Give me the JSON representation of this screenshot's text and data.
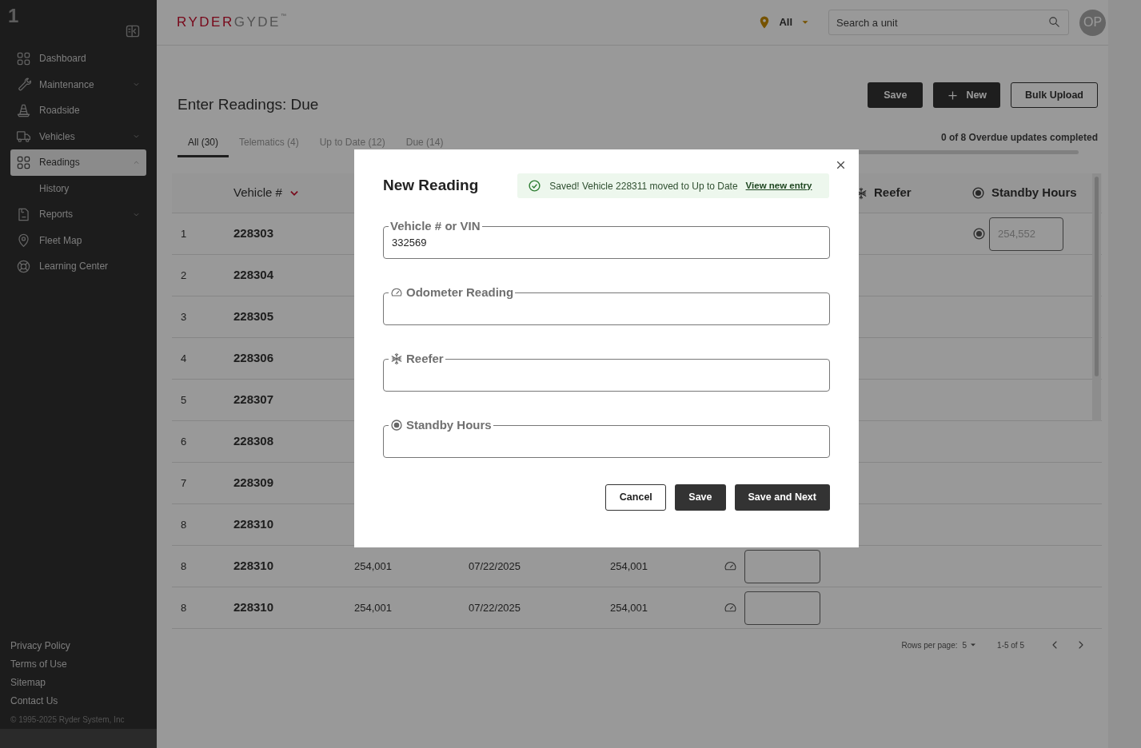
{
  "sidebar": {
    "brand_mark": "1",
    "items": [
      {
        "label": "Dashboard",
        "selected": false
      },
      {
        "label": "Maintenance",
        "selected": false,
        "expanded": false
      },
      {
        "label": "Roadside",
        "selected": false
      },
      {
        "label": "Vehicles",
        "selected": false,
        "expanded": false
      },
      {
        "label": "Readings",
        "selected": true,
        "expanded": true,
        "children": [
          {
            "label": "History",
            "selected": false
          }
        ]
      },
      {
        "label": "Reports",
        "selected": false,
        "expanded": false
      },
      {
        "label": "Fleet Map",
        "selected": false
      },
      {
        "label": "Learning Center",
        "selected": false
      }
    ],
    "footer_links": [
      "Privacy Policy",
      "Terms of Use",
      "Sitemap",
      "Contact Us"
    ],
    "copyright": "© 1995-2025 Ryder System, Inc"
  },
  "header": {
    "logo_primary": "RYDER",
    "logo_secondary": "GYDE",
    "logo_mark": "™",
    "location": "All",
    "search": {
      "placeholder": "Search a unit"
    },
    "avatar": "OP"
  },
  "page": {
    "title": "Enter Readings: Due",
    "actions": [
      {
        "label": "Save",
        "kind": "primary"
      },
      {
        "label": "New",
        "kind": "add"
      },
      {
        "label": "Bulk Upload",
        "kind": "outline"
      }
    ],
    "progress": {
      "text": "0 of 8 Overdue updates completed",
      "level": 0
    }
  },
  "tabs": [
    {
      "label": "All (30)",
      "selected": true
    },
    {
      "label": "Telematics (4)",
      "selected": false
    },
    {
      "label": "Up to Date (12)",
      "selected": false
    },
    {
      "label": "Due (14)",
      "selected": false
    }
  ],
  "table": {
    "columns": [
      {
        "label": "Vehicle #",
        "kind": "sort"
      },
      {
        "label": "Reefer",
        "kind": "reefer"
      },
      {
        "label": "Standby Hours",
        "kind": "standby"
      }
    ],
    "rows": [
      {
        "number": "1",
        "vehicle": "228303",
        "standby_placeholder": "254,552"
      },
      {
        "number": "2",
        "vehicle": "228304"
      },
      {
        "number": "3",
        "vehicle": "228305"
      },
      {
        "number": "4",
        "vehicle": "228306"
      },
      {
        "number": "5",
        "vehicle": "228307"
      },
      {
        "number": "6",
        "vehicle": "228308"
      },
      {
        "number": "7",
        "vehicle": "228309"
      },
      {
        "number": "8",
        "vehicle": "228310"
      },
      {
        "number": "8",
        "vehicle": "228310",
        "column_3": "254,001",
        "column_4": "07/22/2025",
        "column_5": "254,001",
        "odometer_entry": true
      },
      {
        "number": "8",
        "vehicle": "228310",
        "column_3": "254,001",
        "column_4": "07/22/2025",
        "column_5": "254,001",
        "odometer_entry": true
      }
    ],
    "pagination": {
      "rows_label": "Rows per page:",
      "rows_value": "5",
      "range": "1-5 of 5"
    }
  },
  "modal": {
    "title": "New Reading",
    "alert": {
      "message": "Saved! Vehicle 228311 moved to Up to Date",
      "link": "View new entry"
    },
    "fields": [
      {
        "label": "Vehicle # or VIN",
        "kind": "vin",
        "value": "332569"
      },
      {
        "label": "Odometer Reading",
        "kind": "odometer"
      },
      {
        "label": "Reefer",
        "kind": "reefer"
      },
      {
        "label": "Standby Hours",
        "kind": "standby"
      }
    ],
    "buttons": [
      {
        "label": "Cancel",
        "kind": "outline"
      },
      {
        "label": "Save",
        "kind": "primary"
      },
      {
        "label": "Save and Next",
        "kind": "primary"
      }
    ]
  }
}
